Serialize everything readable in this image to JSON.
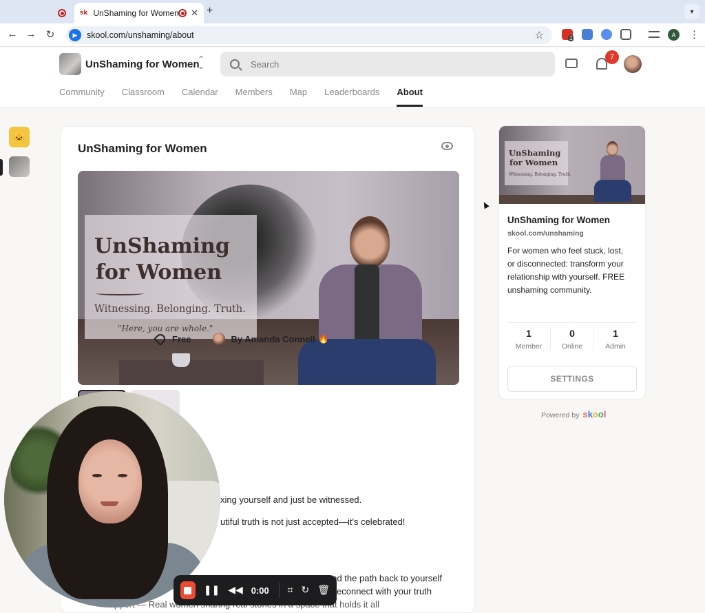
{
  "browser": {
    "active_tab_title": "UnShaming for Women",
    "favicon_text": "sk",
    "new_tab": "+",
    "url": "skool.com/unshaming/about",
    "profile_initial": "A",
    "extension_badge": "1"
  },
  "header": {
    "group_name": "UnShaming for Women",
    "search_placeholder": "Search",
    "notification_count": "7"
  },
  "nav": {
    "tabs": [
      {
        "label": "Community"
      },
      {
        "label": "Classroom"
      },
      {
        "label": "Calendar"
      },
      {
        "label": "Members"
      },
      {
        "label": "Map"
      },
      {
        "label": "Leaderboards"
      },
      {
        "label": "About"
      }
    ],
    "active_tab": "About"
  },
  "main": {
    "title": "UnShaming for Women",
    "hero": {
      "line1": "UnShaming",
      "line2": "for Women",
      "tagline": "Witnessing. Belonging. Truth.",
      "quote": "\"Here, you are whole.\""
    },
    "price": "Free",
    "author": "By Amanda Connell",
    "author_emoji": "🔥",
    "description_fragments": [
      "xing yourself and just be witnessed.",
      "utiful truth is not just accepted—it's celebrated!",
      "and the path back to yourself",
      "econnect with your truth",
      "Support — Real women sharing real stories in a space that holds it all"
    ]
  },
  "sidebar": {
    "title": "UnShaming for Women",
    "url": "skool.com/unshaming",
    "description": "For women who feel stuck, lost,\nor disconnected: transform your\nrelationship with yourself. FREE\nunshaming community.",
    "cover": {
      "line1": "UnShaming",
      "line2": "for Women",
      "tagline": "Witnessing. Belonging. Truth."
    },
    "stats": [
      {
        "value": "1",
        "label": "Member"
      },
      {
        "value": "0",
        "label": "Online"
      },
      {
        "value": "1",
        "label": "Admin"
      }
    ],
    "settings_label": "SETTINGS",
    "powered_by": "Powered by",
    "brand_letters": [
      "s",
      "k",
      "o",
      "o",
      "l"
    ],
    "brand_colors": [
      "#f05a5a",
      "#2e7fd8",
      "#f2b233",
      "#3caa5a",
      "#e85a8a"
    ]
  },
  "recorder": {
    "time": "0:00"
  },
  "colors": {
    "notification_badge": "#e0392b",
    "record_button": "#e94b35"
  }
}
